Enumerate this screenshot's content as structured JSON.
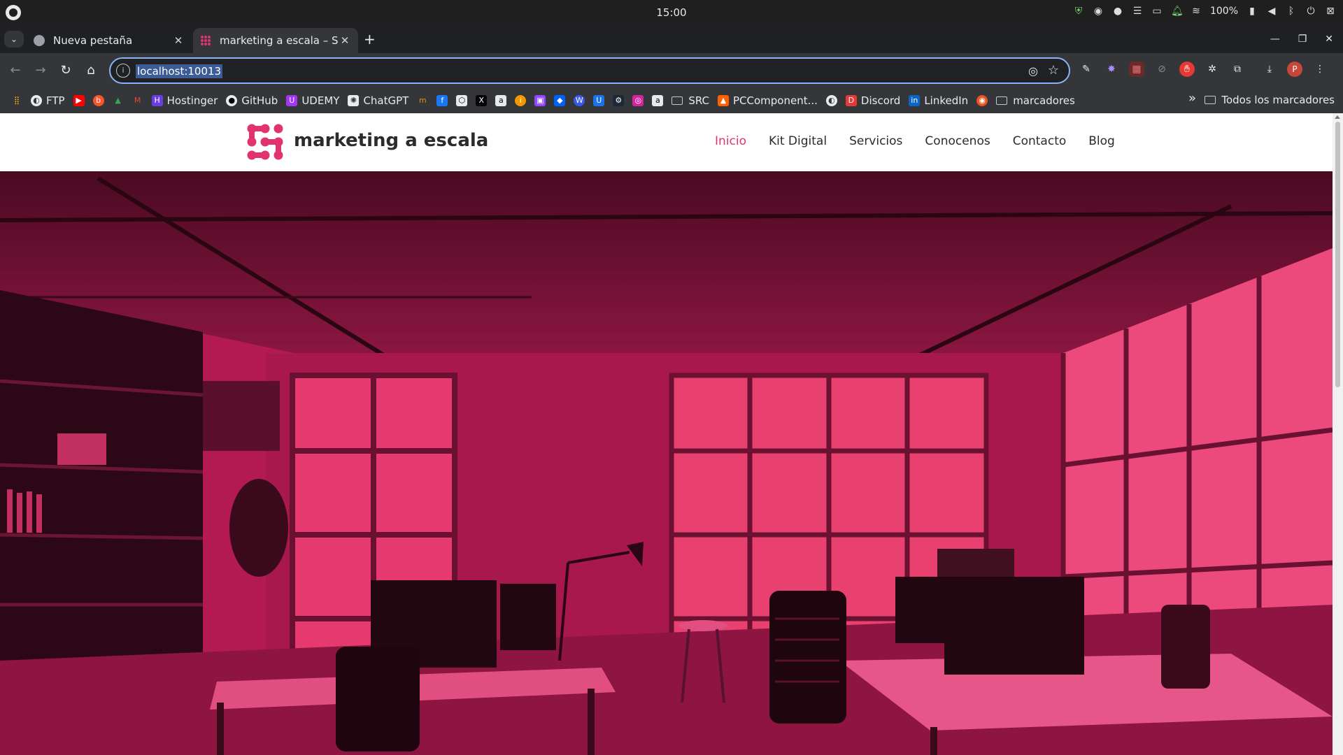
{
  "os": {
    "clock": "15:00",
    "battery": "100%"
  },
  "tabs": [
    {
      "title": "Nueva pestaña",
      "close": "✕"
    },
    {
      "title": "marketing a escala – So",
      "close": "✕"
    }
  ],
  "toolbar": {
    "url": "localhost:10013",
    "avatar_letter": "P"
  },
  "bookmarks": {
    "items": [
      "FTP",
      "Hostinger",
      "GitHub",
      "UDEMY",
      "ChatGPT",
      "SRC",
      "PCComponent...",
      "Discord",
      "LinkedIn",
      "marcadores"
    ],
    "all": "Todos los marcadores"
  },
  "site": {
    "brand": "marketing a escala",
    "nav": [
      "Inicio",
      "Kit Digital",
      "Servicios",
      "Conocenos",
      "Contacto",
      "Blog"
    ],
    "accent": "#e0336f",
    "hero_tint": "#c81d5a"
  }
}
